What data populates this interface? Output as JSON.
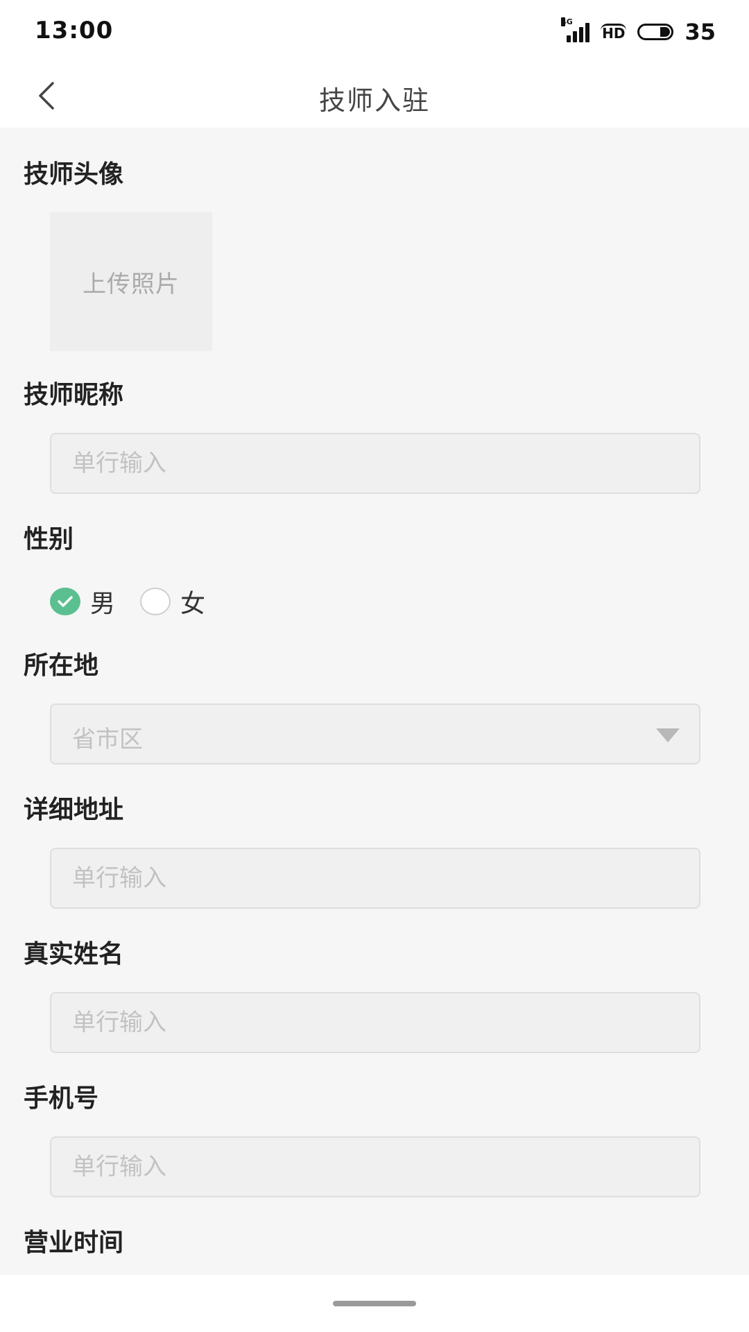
{
  "status_bar": {
    "time": "13:00",
    "network": "4G",
    "hd": "HD",
    "battery": "35"
  },
  "nav": {
    "back_icon": "chevron-left-icon",
    "title": "技师入驻"
  },
  "form": {
    "avatar": {
      "label": "技师头像",
      "upload_text": "上传照片"
    },
    "nickname": {
      "label": "技师昵称",
      "placeholder": "单行输入",
      "value": ""
    },
    "gender": {
      "label": "性别",
      "options": [
        {
          "label": "男",
          "checked": true
        },
        {
          "label": "女",
          "checked": false
        }
      ],
      "accent_color": "#5bbf8f"
    },
    "location": {
      "label": "所在地",
      "placeholder": "省市区",
      "icon": "caret-down-icon"
    },
    "address": {
      "label": "详细地址",
      "placeholder": "单行输入",
      "value": ""
    },
    "real_name": {
      "label": "真实姓名",
      "placeholder": "单行输入",
      "value": ""
    },
    "phone": {
      "label": "手机号",
      "placeholder": "单行输入",
      "value": ""
    },
    "business_hours": {
      "label": "营业时间"
    }
  }
}
